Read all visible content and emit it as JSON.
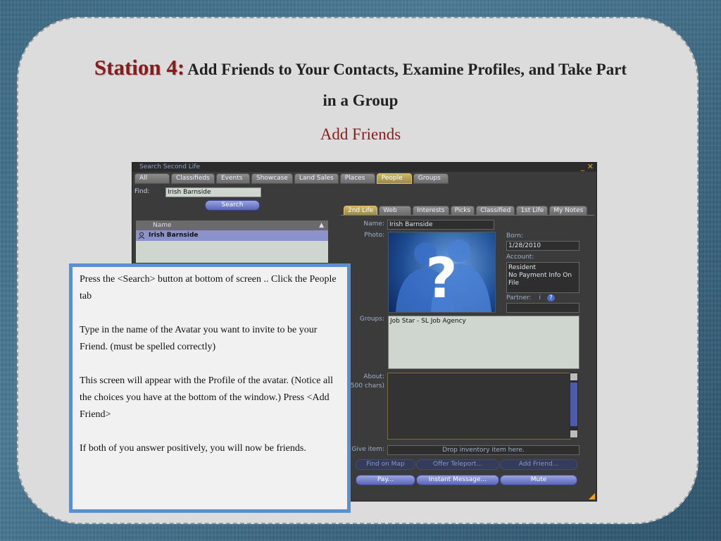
{
  "slide": {
    "station_label": "Station 4:",
    "subtitle_part1": "Add Friends to Your Contacts, Examine Profiles, and Take Part",
    "subtitle_part2": "in a Group",
    "section": "Add Friends"
  },
  "window": {
    "title": "Search Second Life",
    "controls": "_ ✕",
    "tabs": [
      "All",
      "Classifieds",
      "Events",
      "Showcase",
      "Land Sales",
      "Places",
      "People",
      "Groups"
    ],
    "active_tab": "People",
    "find_label": "Find:",
    "find_value": "Irish Barnside",
    "search_button": "Search",
    "results_header": "Name",
    "results_sort": "▲",
    "result_name": "Irish Barnside",
    "profile_tabs": [
      "2nd Life",
      "Web",
      "Interests",
      "Picks",
      "Classified",
      "1st Life",
      "My Notes"
    ],
    "active_profile_tab": "2nd Life",
    "name_label": "Name:",
    "name_value": "Irish Barnside",
    "photo_label": "Photo:",
    "born_label": "Born:",
    "born_value": "1/28/2010",
    "account_label": "Account:",
    "account_line1": "Resident",
    "account_line2": "No Payment Info On File",
    "partner_label": "Partner:",
    "partner_i": "i",
    "partner_q": "?",
    "groups_label": "Groups:",
    "groups_value": "Job Star - SL Job Agency",
    "about_label": "About:",
    "about_sub": "500 chars)",
    "give_label": "Give item:",
    "give_value": "Drop inventory item here.",
    "buttons_row1": [
      "Find on Map",
      "Offer Teleport...",
      "Add Friend..."
    ],
    "buttons_row2": [
      "Pay...",
      "Instant Message...",
      "Mute"
    ]
  },
  "instructions": {
    "p1": "Press the <Search> button at bottom of screen .. Click the People tab",
    "p2": "Type in the name of the Avatar you want to invite to be your Friend.  (must be spelled correctly)",
    "p3": "This screen will appear with the Profile of the avatar.  (Notice all the choices you have at the bottom of the window.)  Press <Add Friend>",
    "p4": "If both of you answer positively, you will now be friends."
  }
}
